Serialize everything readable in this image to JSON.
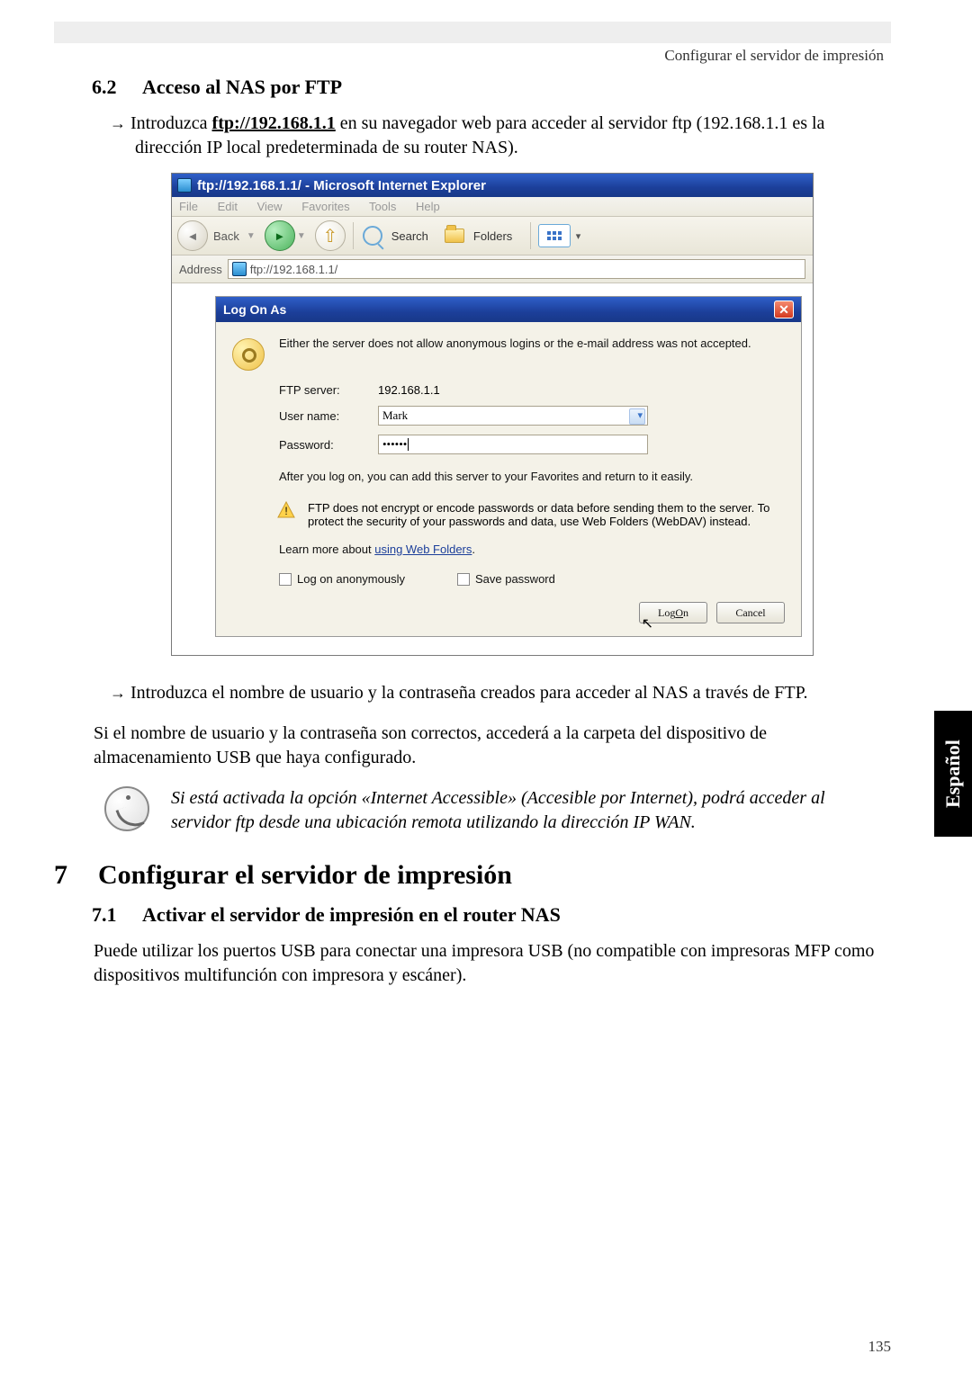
{
  "header": {
    "running": "Configurar el servidor de impresión"
  },
  "section_6_2": {
    "num": "6.2",
    "title": "Acceso al NAS por FTP",
    "bullet1_pre": "Introduzca ",
    "bullet1_link": "ftp://192.168.1.1",
    "bullet1_post": " en su navegador web para acceder al servidor ftp (192.168.1.1 es la dirección IP local predeterminada de su router NAS).",
    "bullet2": "Introduzca el nombre de usuario y la contraseña creados para acceder al NAS a través de FTP.",
    "result_para": "Si el nombre de usuario y la contraseña son correctos, accederá a la carpeta del dispositivo de almacenamiento USB que haya configurado.",
    "note": "Si está activada la opción «Internet Accessible» (Accesible por Internet), podrá acceder al servidor ftp desde una ubicación remota utilizando la dirección IP WAN."
  },
  "section_7": {
    "num": "7",
    "title": "Configurar el servidor de impresión",
    "sub_7_1": {
      "num": "7.1",
      "title": "Activar el servidor de impresión en el router NAS",
      "para": "Puede utilizar los puertos USB para conectar una impresora USB (no compatible con impresoras MFP como dispositivos multifunción con impresora y escáner)."
    }
  },
  "ie": {
    "title": "ftp://192.168.1.1/ - Microsoft Internet Explorer",
    "menu": {
      "file": "File",
      "edit": "Edit",
      "view": "View",
      "favorites": "Favorites",
      "tools": "Tools",
      "help": "Help"
    },
    "toolbar": {
      "back": "Back",
      "search": "Search",
      "folders": "Folders"
    },
    "address_label": "Address",
    "address_value": "ftp://192.168.1.1/",
    "logon": {
      "title": "Log On As",
      "msg": "Either the server does not allow anonymous logins or the e-mail address was not accepted.",
      "ftp_label": "FTP server:",
      "ftp_value": "192.168.1.1",
      "user_label": "User name:",
      "user_value": "Mark",
      "pass_label": "Password:",
      "pass_value": "••••••",
      "after": "After you log on, you can add this server to your Favorites and return to it easily.",
      "warn": "FTP does not encrypt or encode passwords or data before sending them to the server.  To protect the security of your passwords and data, use Web Folders (WebDAV) instead.",
      "learn_pre": "Learn more about ",
      "learn_link": "using Web Folders",
      "anon": "Log on anonymously",
      "save": "Save password",
      "logon_btn_pre": "Log ",
      "logon_btn_u": "O",
      "logon_btn_post": "n",
      "cancel": "Cancel"
    }
  },
  "side_tab": "Español",
  "page_number": "135"
}
